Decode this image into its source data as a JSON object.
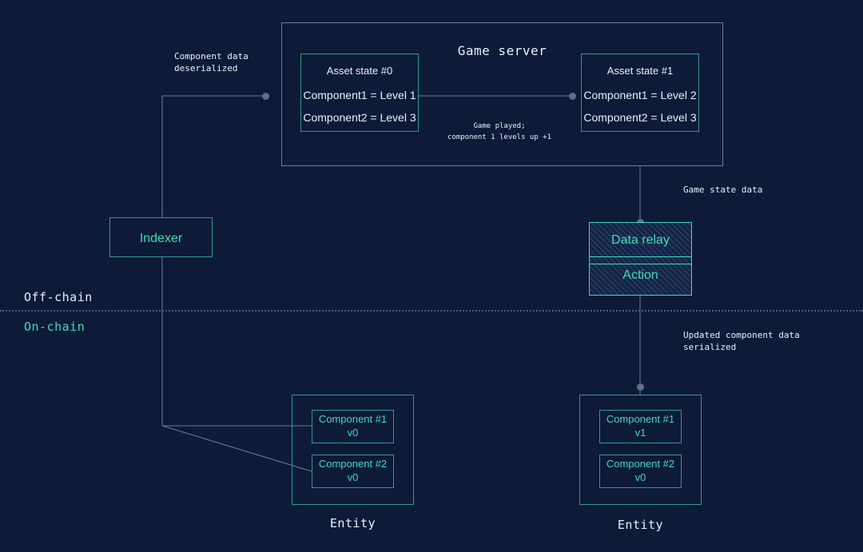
{
  "colors": {
    "background": "#0d1a38",
    "teal": "#3fddb4",
    "teal_border": "#2f9c86",
    "line_blue": "#6b7ba8",
    "dot": "#5d6d92",
    "white": "#eceff7"
  },
  "game_server": {
    "title": "Game server",
    "asset_state_0": {
      "title": "Asset state #0",
      "rows": [
        "Component1 = Level 1",
        "Component2 = Level 3"
      ]
    },
    "asset_state_1": {
      "title": "Asset state #1",
      "rows": [
        "Component1 = Level 2",
        "Component2 = Level 3"
      ]
    },
    "transition_label": "Game played;\ncomponent 1 levels up +1"
  },
  "annotations": {
    "component_data_deserialized": "Component data\ndeserialized",
    "game_state_data": "Game state data",
    "updated_component_data_serialized": "Updated component data\nserialized"
  },
  "indexer": {
    "label": "Indexer"
  },
  "relay": {
    "data_relay_label": "Data relay",
    "action_label": "Action"
  },
  "chain_divider": {
    "off_chain_label": "Off-chain",
    "on_chain_label": "On-chain"
  },
  "entity_left": {
    "caption": "Entity",
    "components": [
      {
        "name": "Component #1",
        "version": "v0"
      },
      {
        "name": "Component #2",
        "version": "v0"
      }
    ]
  },
  "entity_right": {
    "caption": "Entity",
    "components": [
      {
        "name": "Component #1",
        "version": "v1"
      },
      {
        "name": "Component #2",
        "version": "v0"
      }
    ]
  }
}
